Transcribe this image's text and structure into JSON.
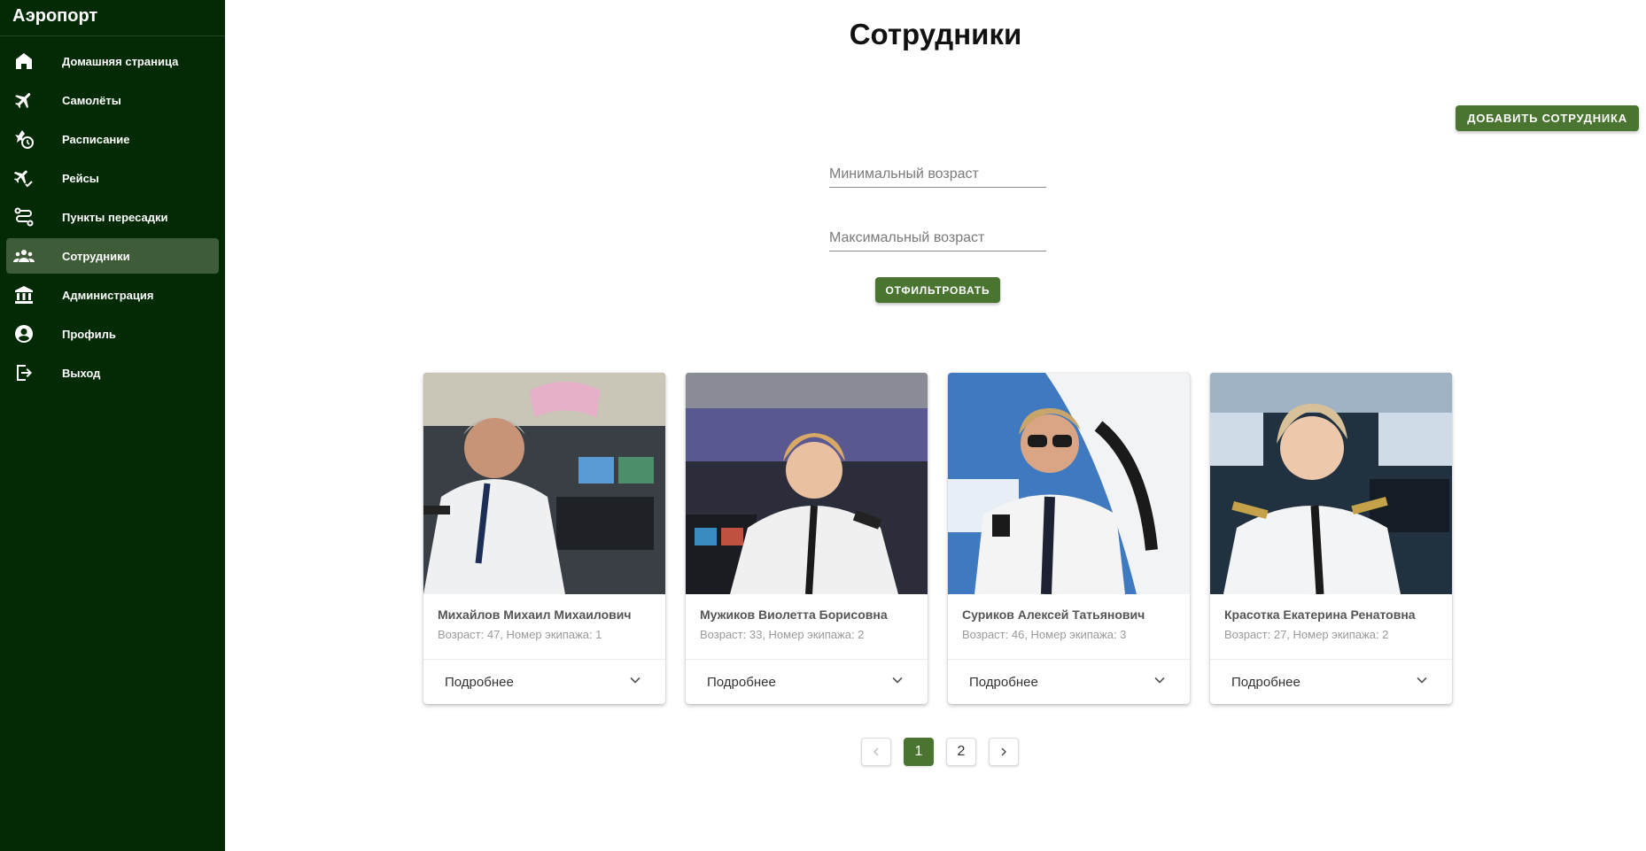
{
  "app": {
    "title": "Аэропорт"
  },
  "sidebar": {
    "items": [
      {
        "label": "Домашняя страница",
        "icon": "home-icon",
        "active": false
      },
      {
        "label": "Самолёты",
        "icon": "airplane-icon",
        "active": false
      },
      {
        "label": "Расписание",
        "icon": "schedule-icon",
        "active": false
      },
      {
        "label": "Рейсы",
        "icon": "flight-check-icon",
        "active": false
      },
      {
        "label": "Пункты пересадки",
        "icon": "route-icon",
        "active": false
      },
      {
        "label": "Сотрудники",
        "icon": "people-icon",
        "active": true
      },
      {
        "label": "Администрация",
        "icon": "building-icon",
        "active": false
      },
      {
        "label": "Профиль",
        "icon": "account-icon",
        "active": false
      },
      {
        "label": "Выход",
        "icon": "logout-icon",
        "active": false
      }
    ]
  },
  "page": {
    "title": "Сотрудники",
    "add_button": "Добавить сотрудника",
    "min_age_placeholder": "Минимальный возраст",
    "max_age_placeholder": "Максимальный возраст",
    "filter_button": "Отфильтровать"
  },
  "employees": [
    {
      "name": "Михайлов Михаил Михаилович",
      "details": "Возраст: 47, Номер экипажа: 1",
      "more": "Подробнее"
    },
    {
      "name": "Мужиков Виолетта Борисовна",
      "details": "Возраст: 33, Номер экипажа: 2",
      "more": "Подробнее"
    },
    {
      "name": "Суриков Алексей Татьянович",
      "details": "Возраст: 46, Номер экипажа: 3",
      "more": "Подробнее"
    },
    {
      "name": "Красотка Екатерина Ренатовна",
      "details": "Возраст: 27, Номер экипажа: 2",
      "more": "Подробнее"
    }
  ],
  "pagination": {
    "pages": [
      "1",
      "2"
    ],
    "current": "1"
  },
  "colors": {
    "sidebar": "#022b05",
    "sidebar_active": "#3e5c37",
    "accent": "#4a7530"
  }
}
